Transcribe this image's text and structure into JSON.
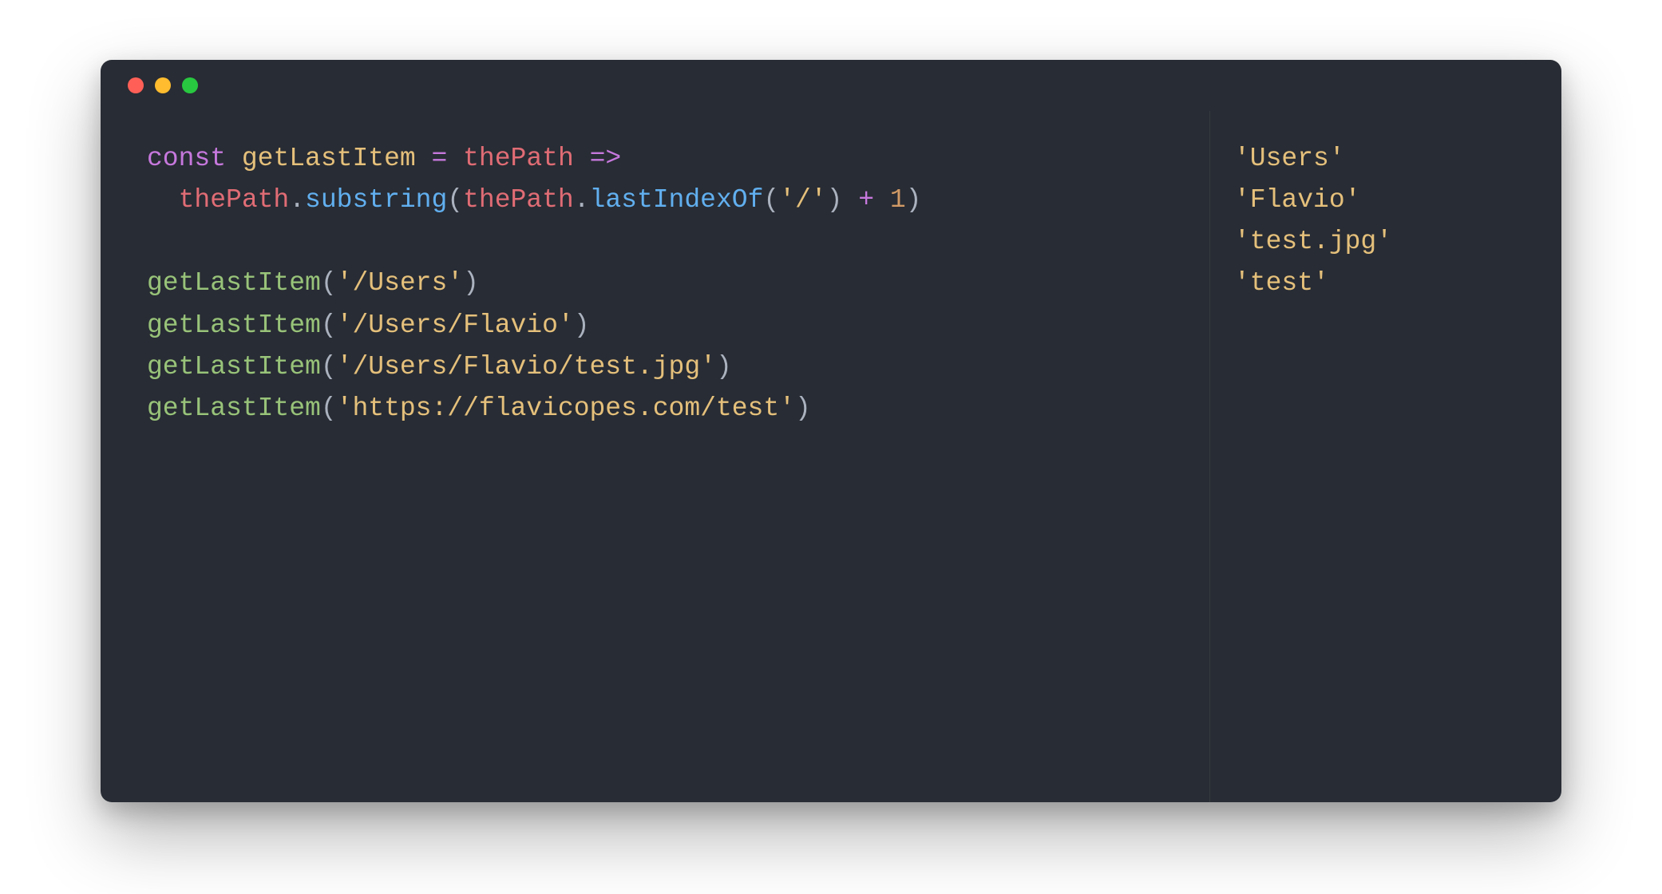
{
  "code": {
    "kw_const": "const",
    "decl_name": "getLastItem",
    "op_assign": "=",
    "param": "thePath",
    "op_arrow": "=>",
    "indent": "  ",
    "dot": ".",
    "method_substring": "substring",
    "lparen": "(",
    "rparen": ")",
    "method_lastIndexOf": "lastIndexOf",
    "str_slash": "'/'",
    "op_plus": "+",
    "num_one": "1",
    "calls": [
      {
        "fn": "getLastItem",
        "arg": "'/Users'"
      },
      {
        "fn": "getLastItem",
        "arg": "'/Users/Flavio'"
      },
      {
        "fn": "getLastItem",
        "arg": "'/Users/Flavio/test.jpg'"
      },
      {
        "fn": "getLastItem",
        "arg": "'https://flavicopes.com/test'"
      }
    ]
  },
  "output": [
    "'Users'",
    "'Flavio'",
    "'test.jpg'",
    "'test'"
  ]
}
